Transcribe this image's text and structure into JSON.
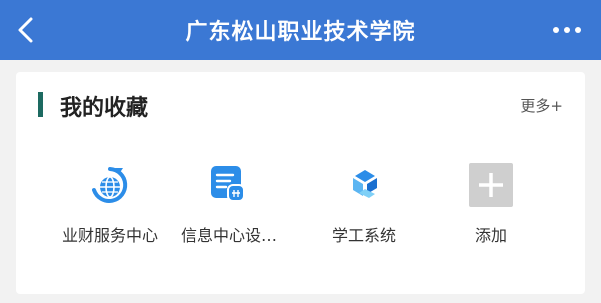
{
  "header": {
    "title": "广东松山职业技术学院",
    "back_icon": "chevron-left-icon",
    "more_icon": "ellipsis-icon"
  },
  "favorites": {
    "title": "我的收藏",
    "more_label": "更多+",
    "accent_color": "#1d6a61",
    "items": [
      {
        "label": "业财服务中心",
        "icon": "finance-globe-icon"
      },
      {
        "label": "信息中心设…",
        "icon": "info-center-icon"
      },
      {
        "label": "学工系统",
        "icon": "student-affairs-icon"
      },
      {
        "label": "添加",
        "icon": "add-plus-icon"
      }
    ]
  },
  "colors": {
    "header_bg": "#3b78d4",
    "page_bg": "#f2f2f2",
    "icon_blue": "#2c8de8"
  }
}
